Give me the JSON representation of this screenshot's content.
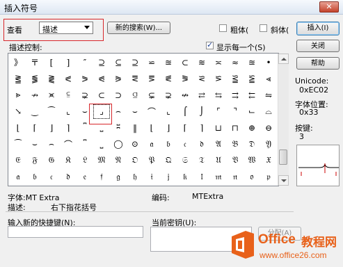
{
  "window": {
    "title": "插入符号",
    "close_icon": "close-x-icon"
  },
  "view": {
    "label": "查看",
    "selected": "描述"
  },
  "buttons": {
    "new_search": "新的搜索(W)...",
    "insert": "插入(I)",
    "close": "关闭",
    "help": "帮助",
    "assign": "分配(A)"
  },
  "options": {
    "bold_label": "粗体(",
    "bold_checked": false,
    "italic_label": "斜体(",
    "italic_checked": false,
    "show_each_label": "显示每一个(S)",
    "show_each_checked": true
  },
  "grid": {
    "label": "描述控制:",
    "cells": [
      [
        "》",
        "〒",
        "[",
        "]",
        "″",
        "⊇",
        "⊆",
        "⊇",
        "⋍",
        "≊",
        "⊂",
        "≋",
        "≍",
        "≈",
        "≊",
        "•"
      ],
      [
        "⪒",
        "⪓",
        "⪔",
        "⪕",
        "⪖",
        "⪗",
        "⪘",
        "⪙",
        "⪚",
        "⪛",
        "⪜",
        "⪝",
        "⪞",
        "⪟",
        "⪠",
        "⪡"
      ],
      [
        "⪢",
        "↛",
        "⪤",
        "⫅",
        "⊋",
        "⊂",
        "⊃",
        "⫑",
        "⊊",
        "⊋",
        "↮",
        "⇄",
        "⇆",
        "⇉",
        "⇇",
        "⇋"
      ],
      [
        "↘",
        "‿",
        "⁀",
        "⌞",
        "⌣",
        "⌟",
        "⌢",
        "⌣",
        "⌒",
        "⌞",
        "⌠",
        "⌡",
        "⌜",
        "⌝",
        "⌙",
        "⌓"
      ],
      [
        "⌊",
        "⌈",
        "⌋",
        "⌉",
        "⎴",
        "⎵",
        "⎶",
        "‖",
        "⌊",
        "⌋",
        "⌈",
        "⌉",
        "⊔",
        "⊓",
        "⊕",
        "⊖"
      ],
      [
        "⁀",
        "⌣",
        "⌢",
        "⌒",
        "⎴",
        "⎵",
        "◯",
        "⊙",
        "𝔞",
        "𝔟",
        "𝔠",
        "𝔡",
        "𝔄",
        "𝔅",
        "𝔇",
        "𝔜"
      ],
      [
        "𝔈",
        "𝔉",
        "𝔊",
        "𝔎",
        "𝔏",
        "𝔐",
        "𝔑",
        "𝔒",
        "𝔓",
        "𝔔",
        "𝔖",
        "𝔗",
        "𝔘",
        "𝔙",
        "𝔚",
        "𝔛"
      ],
      [
        "𝔞",
        "𝔟",
        "𝔠",
        "𝔡",
        "𝔢",
        "𝔣",
        "𝔤",
        "𝔥",
        "𝔦",
        "𝔧",
        "𝔨",
        "𝔩",
        "𝔪",
        "𝔫",
        "𝔬",
        "𝔭"
      ]
    ],
    "selected_row": 3,
    "selected_col": 5
  },
  "info": {
    "unicode_label": "Unicode:",
    "unicode_value": "0xEC02",
    "char_pos_label": "字体位置:",
    "char_pos_value": "0x33",
    "keystroke_label": "按键:",
    "keystroke_value": "3"
  },
  "details": {
    "font_label": "字体:MT Extra",
    "encoding_label": "编码:",
    "encoding_value": "MTExtra",
    "desc_label": "描述:",
    "desc_value": "右下指花括号"
  },
  "shortcut": {
    "new_label": "输入新的快捷键(N):",
    "current_label": "当前密钥(U):",
    "new_value": "",
    "current_value": ""
  },
  "watermark": {
    "brand_a": "Office",
    "brand_b": "教程网",
    "url": "www.office26.com",
    "brand_color": "#e8611a"
  }
}
